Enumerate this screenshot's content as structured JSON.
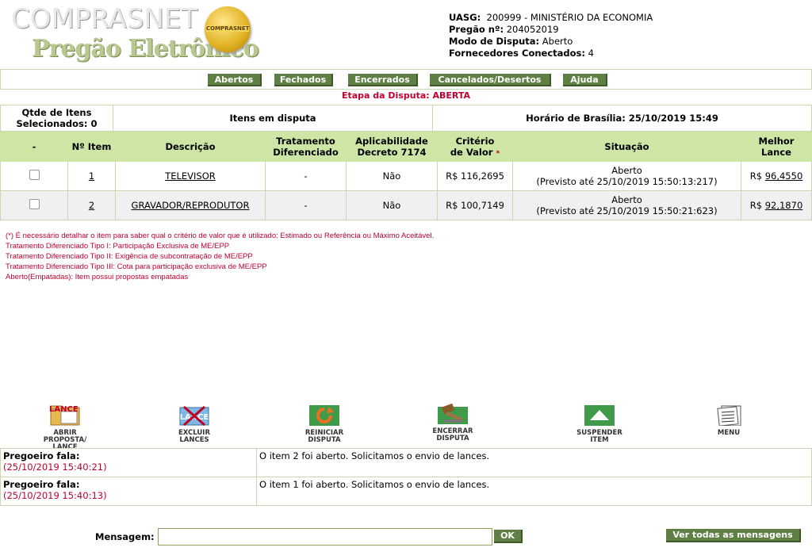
{
  "header": {
    "logo_title": "COMPRASNET",
    "logo_subtitle": "Pregão Eletrônico",
    "seal_text": "COMPRASNET",
    "uasg_label": "UASG:",
    "uasg_value": "200999 - MINISTÉRIO DA ECONOMIA",
    "pregao_label": "Pregão nº:",
    "pregao_value": "204052019",
    "modo_label": "Modo de Disputa:",
    "modo_value": "Aberto",
    "fornecedores_label": "Fornecedores Conectados:",
    "fornecedores_value": "4"
  },
  "nav": [
    "Abertos",
    "Fechados",
    "Encerrados",
    "Cancelados/Desertos",
    "Ajuda"
  ],
  "etapa": "Etapa da Disputa: ABERTA",
  "summary": {
    "qtde_line1": "Qtde de Itens",
    "qtde_line2": "Selecionados: 0",
    "itens_em_disputa": "Itens em disputa",
    "horario": "Horário de Brasília: 25/10/2019 15:49"
  },
  "table": {
    "headers": {
      "check": "-",
      "item": "Nº Item",
      "descricao": "Descrição",
      "tratamento_1": "Tratamento",
      "tratamento_2": "Diferenciado",
      "aplic_1": "Aplicabilidade",
      "aplic_2": "Decreto 7174",
      "criterio_1": "Critério",
      "criterio_2": "de Valor",
      "criterio_star": "*",
      "situacao": "Situação",
      "melhor_lance": "Melhor Lance"
    },
    "rows": [
      {
        "item": "1",
        "descricao": "TELEVISOR",
        "tratamento": "-",
        "aplicabilidade": "Não",
        "criterio": "R$ 116,2695",
        "situacao_1": "Aberto",
        "situacao_2": "(Previsto até 25/10/2019 15:50:13:217)",
        "lance_prefix": "R$",
        "lance_value": "96,4550"
      },
      {
        "item": "2",
        "descricao": "GRAVADOR/REPRODUTOR",
        "tratamento": "-",
        "aplicabilidade": "Não",
        "criterio": "R$ 100,7149",
        "situacao_1": "Aberto",
        "situacao_2": "(Previsto até 25/10/2019 15:50:21:623)",
        "lance_prefix": "R$",
        "lance_value": "92,1870"
      }
    ]
  },
  "notes": [
    "(*) É necessário detalhar o item para saber qual o critério de valor que é utilizado: Estimado ou Referência ou Máximo Aceitável.",
    "Tratamento Diferenciado Tipo I: Participação Exclusiva de ME/EPP",
    "Tratamento Diferenciado Tipo II: Exigência de subcontratação de ME/EPP",
    "Tratamento Diferenciado Tipo III: Cota para participação exclusiva de ME/EPP",
    "Aberto(Empatadas): Item possui propostas empatadas"
  ],
  "actions": {
    "abrir": [
      "ABRIR",
      "PROPOSTA/",
      "LANCE"
    ],
    "excluir": [
      "EXCLUIR",
      "LANCES"
    ],
    "reiniciar": [
      "REINICIAR",
      "DISPUTA"
    ],
    "encerrar": [
      "ENCERRAR",
      "DISPUTA"
    ],
    "suspender": [
      "SUSPENDER",
      "ITEM"
    ],
    "menu": [
      "MENU"
    ],
    "lance_icon_text": "LANCE"
  },
  "chat": [
    {
      "speaker": "Pregoeiro fala:",
      "time": "(25/10/2019 15:40:21)",
      "text": "O item 2 foi aberto. Solicitamos o envio de lances."
    },
    {
      "speaker": "Pregoeiro fala:",
      "time": "(25/10/2019 15:40:13)",
      "text": "O item 1 foi aberto. Solicitamos o envio de lances."
    }
  ],
  "message": {
    "label": "Mensagem:",
    "value": "",
    "ok": "OK",
    "ver_todas": "Ver todas as mensagens"
  },
  "colors": {
    "button_green": "#5f7f44",
    "header_green": "#cde6a6",
    "accent_red": "#c00030"
  }
}
